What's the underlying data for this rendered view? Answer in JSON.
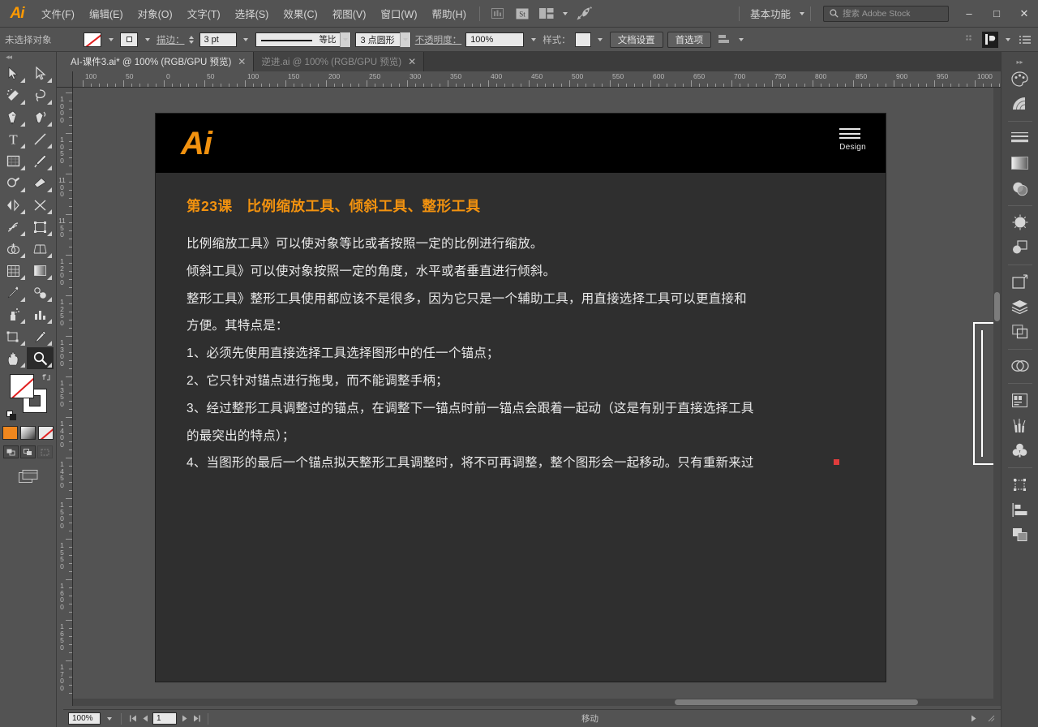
{
  "app": {
    "name": "Adobe Illustrator",
    "logo_text": "Ai",
    "accent_color": "#ff9a00",
    "chrome_bg": "#535353"
  },
  "menubar": {
    "items": [
      {
        "label": "文件(F)",
        "name": "menu-file"
      },
      {
        "label": "编辑(E)",
        "name": "menu-edit"
      },
      {
        "label": "对象(O)",
        "name": "menu-object"
      },
      {
        "label": "文字(T)",
        "name": "menu-type"
      },
      {
        "label": "选择(S)",
        "name": "menu-select"
      },
      {
        "label": "效果(C)",
        "name": "menu-effect"
      },
      {
        "label": "视图(V)",
        "name": "menu-view"
      },
      {
        "label": "窗口(W)",
        "name": "menu-window"
      },
      {
        "label": "帮助(H)",
        "name": "menu-help"
      }
    ],
    "bridge_icon": "bridge-icon",
    "stock_icon": "stock-icon",
    "arrange_icon": "arrange-documents-icon",
    "rocket_icon": "rocket-icon",
    "workspace": "基本功能",
    "search_placeholder": "搜索 Adobe Stock",
    "minimize": "–",
    "maximize": "□",
    "close": "✕"
  },
  "controlbar": {
    "selection_status": "未选择对象",
    "fill_swatch": "none-fill-swatch",
    "stroke_swatch": "stroke-swatch",
    "stroke_label": "描边：",
    "stroke_weight": "3 pt",
    "profile_label": "等比",
    "brush_label": "3 点圆形",
    "opacity_label": "不透明度：",
    "opacity_value": "100%",
    "style_label": "样式：",
    "doc_setup_button": "文档设置",
    "preferences_button": "首选项",
    "align_label": "align-icon"
  },
  "tabs": [
    {
      "label": "AI-课件3.ai* @ 100% (RGB/GPU 预览)",
      "active": true,
      "close": "✕"
    },
    {
      "label": "逆进.ai @ 100% (RGB/GPU 预览)",
      "active": false,
      "close": "✕"
    }
  ],
  "rulers": {
    "horizontal": [
      "100",
      "50",
      "0",
      "50",
      "100",
      "150",
      "200",
      "250",
      "300",
      "350",
      "400",
      "450",
      "500",
      "550",
      "600",
      "650",
      "700",
      "750",
      "800",
      "850",
      "900",
      "950",
      "1000"
    ],
    "vertical": [
      "1000",
      "1050",
      "1100",
      "1150",
      "1200",
      "1250",
      "1300",
      "1350",
      "1400",
      "1450",
      "1500",
      "1550",
      "1600",
      "1650",
      "1700"
    ]
  },
  "toolbar": {
    "tools": [
      {
        "name": "selection-tool",
        "icon": "arrow-solid"
      },
      {
        "name": "direct-selection-tool",
        "icon": "arrow-hollow"
      },
      {
        "name": "magic-wand-tool",
        "icon": "wand"
      },
      {
        "name": "lasso-tool",
        "icon": "lasso"
      },
      {
        "name": "pen-tool",
        "icon": "pen"
      },
      {
        "name": "curvature-tool",
        "icon": "curvature"
      },
      {
        "name": "type-tool",
        "icon": "type-T"
      },
      {
        "name": "line-segment-tool",
        "icon": "line"
      },
      {
        "name": "rectangle-tool",
        "icon": "rectangle"
      },
      {
        "name": "paintbrush-tool",
        "icon": "paintbrush"
      },
      {
        "name": "shaper-tool",
        "icon": "shaper"
      },
      {
        "name": "eraser-tool",
        "icon": "eraser"
      },
      {
        "name": "rotate-tool",
        "icon": "rotate"
      },
      {
        "name": "scale-tool",
        "icon": "scale"
      },
      {
        "name": "width-tool",
        "icon": "width"
      },
      {
        "name": "free-transform-tool",
        "icon": "free-transform"
      },
      {
        "name": "shape-builder-tool",
        "icon": "shape-builder"
      },
      {
        "name": "perspective-grid-tool",
        "icon": "perspective-grid"
      },
      {
        "name": "mesh-tool",
        "icon": "mesh"
      },
      {
        "name": "gradient-tool",
        "icon": "gradient"
      },
      {
        "name": "eyedropper-tool",
        "icon": "eyedropper"
      },
      {
        "name": "blend-tool",
        "icon": "blend"
      },
      {
        "name": "symbol-sprayer-tool",
        "icon": "symbol-sprayer"
      },
      {
        "name": "column-graph-tool",
        "icon": "bar-chart"
      },
      {
        "name": "artboard-tool",
        "icon": "artboard"
      },
      {
        "name": "slice-tool",
        "icon": "slice"
      },
      {
        "name": "hand-tool",
        "icon": "hand"
      },
      {
        "name": "zoom-tool",
        "icon": "magnifier",
        "active": true
      }
    ],
    "fill_stroke": {
      "fill": "none",
      "stroke": "white",
      "swap_icon": "swap-fill-stroke-icon",
      "default_icon": "default-fill-stroke-icon"
    },
    "modes": [
      {
        "name": "color-mode-button",
        "kind": "color"
      },
      {
        "name": "gradient-mode-button",
        "kind": "grad"
      },
      {
        "name": "none-mode-button",
        "kind": "none"
      }
    ],
    "screen_modes": [
      {
        "name": "drawing-normal-button"
      },
      {
        "name": "drawing-behind-button"
      },
      {
        "name": "drawing-inside-button"
      }
    ],
    "change_screen_mode": "change-screen-mode-button"
  },
  "slide": {
    "logo": "Ai",
    "menu_icon": "hamburger-menu-icon",
    "menu_label": "Design",
    "title": "第23课　比例缩放工具、倾斜工具、整形工具",
    "paragraphs": [
      "比例缩放工具》可以使对象等比或者按照一定的比例进行缩放。",
      "倾斜工具》可以使对象按照一定的角度，水平或者垂直进行倾斜。",
      "整形工具》整形工具使用都应该不是很多，因为它只是一个辅助工具，用直接选择工具可以更直接和",
      "方便。其特点是：",
      "1、必须先使用直接选择工具选择图形中的任一个锚点；",
      "2、它只针对锚点进行拖曳，而不能调整手柄；",
      "3、经过整形工具调整过的锚点，在调整下一锚点时前一锚点会跟着一起动（这是有别于直接选择工具",
      "的最突出的特点）；",
      "4、当图形的最后一个锚点拟天整形工具调整时，将不可再调整，整个图形会一起移动。只有重新来过"
    ],
    "bg_color": "#2f2f2f",
    "header_bg": "#000000",
    "title_color": "#f2920f",
    "text_color": "#e9e9e9"
  },
  "statusbar": {
    "zoom": "100%",
    "page": "1",
    "tool_status": "移动",
    "first_icon": "first-page-icon",
    "prev_icon": "previous-page-icon",
    "next_icon": "next-page-icon",
    "last_icon": "last-page-icon"
  },
  "rightdock": {
    "groups": [
      [
        {
          "name": "color-panel-icon",
          "glyph": "color"
        },
        {
          "name": "color-guide-panel-icon",
          "glyph": "guide"
        }
      ],
      [
        {
          "name": "stroke-panel-icon",
          "glyph": "stroke"
        },
        {
          "name": "gradient-panel-icon",
          "glyph": "gradient"
        },
        {
          "name": "transparency-panel-icon",
          "glyph": "transparency"
        }
      ],
      [
        {
          "name": "appearance-panel-icon",
          "glyph": "appearance"
        },
        {
          "name": "graphic-styles-panel-icon",
          "glyph": "styles"
        }
      ],
      [
        {
          "name": "symbols-panel-icon",
          "glyph": "symbols"
        },
        {
          "name": "layers-panel-icon",
          "glyph": "layers"
        },
        {
          "name": "artboards-panel-icon",
          "glyph": "artboards"
        }
      ],
      [
        {
          "name": "links-panel-icon",
          "glyph": "links"
        }
      ],
      [
        {
          "name": "libraries-panel-icon",
          "glyph": "libraries"
        },
        {
          "name": "brushes-panel-icon",
          "glyph": "brushes"
        },
        {
          "name": "swatches-panel-icon",
          "glyph": "swatches"
        }
      ],
      [
        {
          "name": "transform-panel-icon",
          "glyph": "transform"
        },
        {
          "name": "align-panel-icon",
          "glyph": "align"
        },
        {
          "name": "pathfinder-panel-icon",
          "glyph": "pathfinder"
        }
      ]
    ]
  }
}
